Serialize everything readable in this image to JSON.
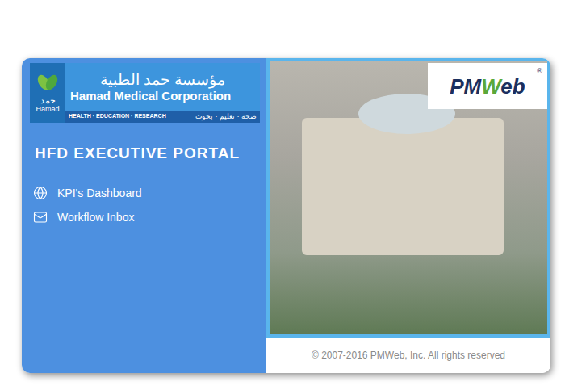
{
  "logo": {
    "arabic_name": "مؤسسة حمد الطبية",
    "english_name": "Hamad Medical Corporation",
    "tagline": "HEALTH · EDUCATION · RESEARCH",
    "arabic_tagline": "صحة · تعليم · بحوث",
    "badge_arabic": "حمد",
    "badge_english": "Hamad"
  },
  "title": "HFD EXECUTIVE PORTAL",
  "menu": [
    {
      "label": "KPI's Dashboard",
      "kind": "globe"
    },
    {
      "label": "Workflow Inbox",
      "kind": "mail"
    }
  ],
  "brand": {
    "parts": [
      "PM",
      "W",
      "eb"
    ],
    "mark": "®"
  },
  "footer": "© 2007-2016 PMWeb, Inc. All rights reserved"
}
